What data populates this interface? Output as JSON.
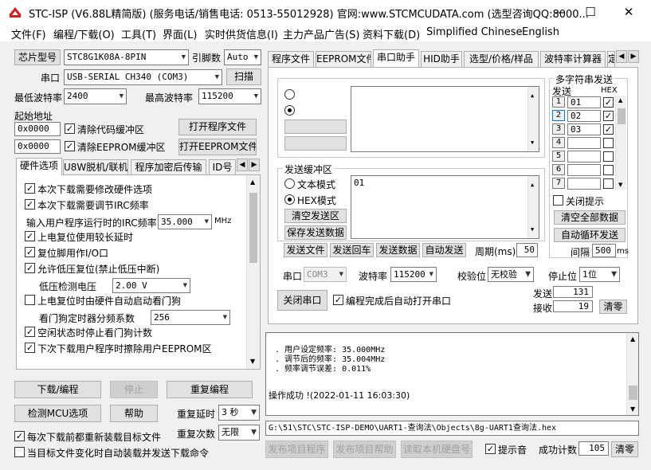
{
  "window": {
    "title": "STC-ISP (V6.88L精简版) (服务电话/销售电话: 0513-55012928) 官网:www.STCMCUDATA.com  (选型咨询QQ:8000...",
    "min": "—",
    "max": "☐",
    "close": "✕"
  },
  "menu": [
    "文件(F)",
    "编程/下载(O)",
    "工具(T)",
    "界面(L)",
    "实时供货信息(I)",
    "主力产品广告(S)",
    "资料下载(D)",
    "Simplified Chinese",
    "English"
  ],
  "left": {
    "chip_label": "芯片型号",
    "chip_value": "STC8G1K08A-8PIN",
    "pins_label": "引脚数",
    "pins_value": "Auto",
    "port_label": "串口",
    "port_value": "USB-SERIAL CH340 (COM3)",
    "scan_btn": "扫描",
    "min_baud_label": "最低波特率",
    "min_baud": "2400",
    "max_baud_label": "最高波特率",
    "max_baud": "115200",
    "start_addr_label": "起始地址",
    "addr1": "0x0000",
    "clear_code": "清除代码缓冲区",
    "open_prog": "打开程序文件",
    "addr2": "0x0000",
    "clear_eeprom": "清除EEPROM缓冲区",
    "open_eeprom": "打开EEPROM文件",
    "tabs": [
      "硬件选项",
      "U8W脱机/联机",
      "程序加密后传输",
      "ID号"
    ],
    "options": [
      {
        "type": "check",
        "checked": true,
        "label": "本次下载需要修改硬件选项"
      },
      {
        "type": "check",
        "checked": true,
        "label": "本次下载需要调节IRC频率"
      },
      {
        "type": "freq",
        "label": "输入用户程序运行时的IRC频率",
        "value": "35.000",
        "unit": "MHz"
      },
      {
        "type": "check",
        "checked": true,
        "label": "上电复位使用较长延时"
      },
      {
        "type": "check",
        "checked": true,
        "label": "复位脚用作I/O口"
      },
      {
        "type": "check",
        "checked": true,
        "label": "允许低压复位(禁止低压中断)"
      },
      {
        "type": "combo",
        "label": "低压检测电压",
        "value": "2.00 V"
      },
      {
        "type": "check",
        "checked": false,
        "label": "上电复位时由硬件自动启动看门狗"
      },
      {
        "type": "combo",
        "label": "看门狗定时器分频系数",
        "value": "256"
      },
      {
        "type": "check",
        "checked": true,
        "label": "空闲状态时停止看门狗计数"
      },
      {
        "type": "check",
        "checked": true,
        "label": "下次下载用户程序时擦除用户EEPROM区"
      }
    ],
    "download_btn": "下载/编程",
    "stop_btn": "停止",
    "reprogram_btn": "重复编程",
    "detect_btn": "检测MCU选项",
    "help_btn": "帮助",
    "repeat_delay_label": "重复延时",
    "repeat_delay": "3 秒",
    "repeat_count_label": "重复次数",
    "repeat_count": "无限",
    "reload_check": "每次下载前都重新装载目标文件",
    "auto_check": "当目标文件变化时自动装载并发送下载命令"
  },
  "right": {
    "tabs": [
      "程序文件",
      "EEPROM文件",
      "串口助手",
      "HID助手",
      "选型/价格/样品",
      "波特率计算器",
      "定"
    ],
    "recv": "19",
    "send": {
      "title": "发送缓冲区",
      "text_mode": "文本模式",
      "hex_mode": "HEX模式",
      "clear": "清空发送区",
      "save": "保存发送数据",
      "content": "01"
    },
    "send_btns": [
      "发送文件",
      "发送回车",
      "发送数据",
      "自动发送"
    ],
    "period_label": "周期(ms)",
    "period": "50",
    "multi": {
      "title": "多字符串发送",
      "send_col": "发送",
      "hex_col": "HEX",
      "rows": [
        {
          "n": "1",
          "v": "01",
          "hex": true
        },
        {
          "n": "2",
          "v": "02",
          "hex": true
        },
        {
          "n": "3",
          "v": "03",
          "hex": true
        },
        {
          "n": "4",
          "v": "",
          "hex": false
        },
        {
          "n": "5",
          "v": "",
          "hex": false
        },
        {
          "n": "6",
          "v": "",
          "hex": false
        },
        {
          "n": "7",
          "v": "",
          "hex": false
        }
      ],
      "close_tip": "关闭提示",
      "clear_all": "清空全部数据",
      "auto_loop": "自动循环发送",
      "interval_label": "间隔",
      "interval": "500",
      "interval_unit": "ms"
    },
    "port_label": "串口",
    "port": "COM3",
    "baud_label": "波特率",
    "baud": "115200",
    "parity_label": "校验位",
    "parity": "无校验",
    "stop_label": "停止位",
    "stop": "1位",
    "close_port": "关闭串口",
    "auto_open": "编程完成后自动打开串口",
    "sent_label": "发送",
    "sent": "131",
    "recv_label": "接收",
    "clear_cnt": "清零",
    "log": [
      ". 用户设定频率: 35.000MHz",
      ". 调节后的频率: 35.004MHz",
      ". 频率调节误差: 0.011%",
      "",
      "操作成功 !(2022-01-11 16:03:30)"
    ],
    "path": "G:\\51\\STC\\STC-ISP-DEMO\\UART1-查询法\\Objects\\8g-UART1查询法.hex",
    "bottom_btns": [
      "发布项目程序",
      "发布项目帮助",
      "读取本机硬盘号"
    ],
    "sound": "提示音",
    "success_label": "成功计数",
    "success": "105",
    "clear_success": "清零"
  }
}
